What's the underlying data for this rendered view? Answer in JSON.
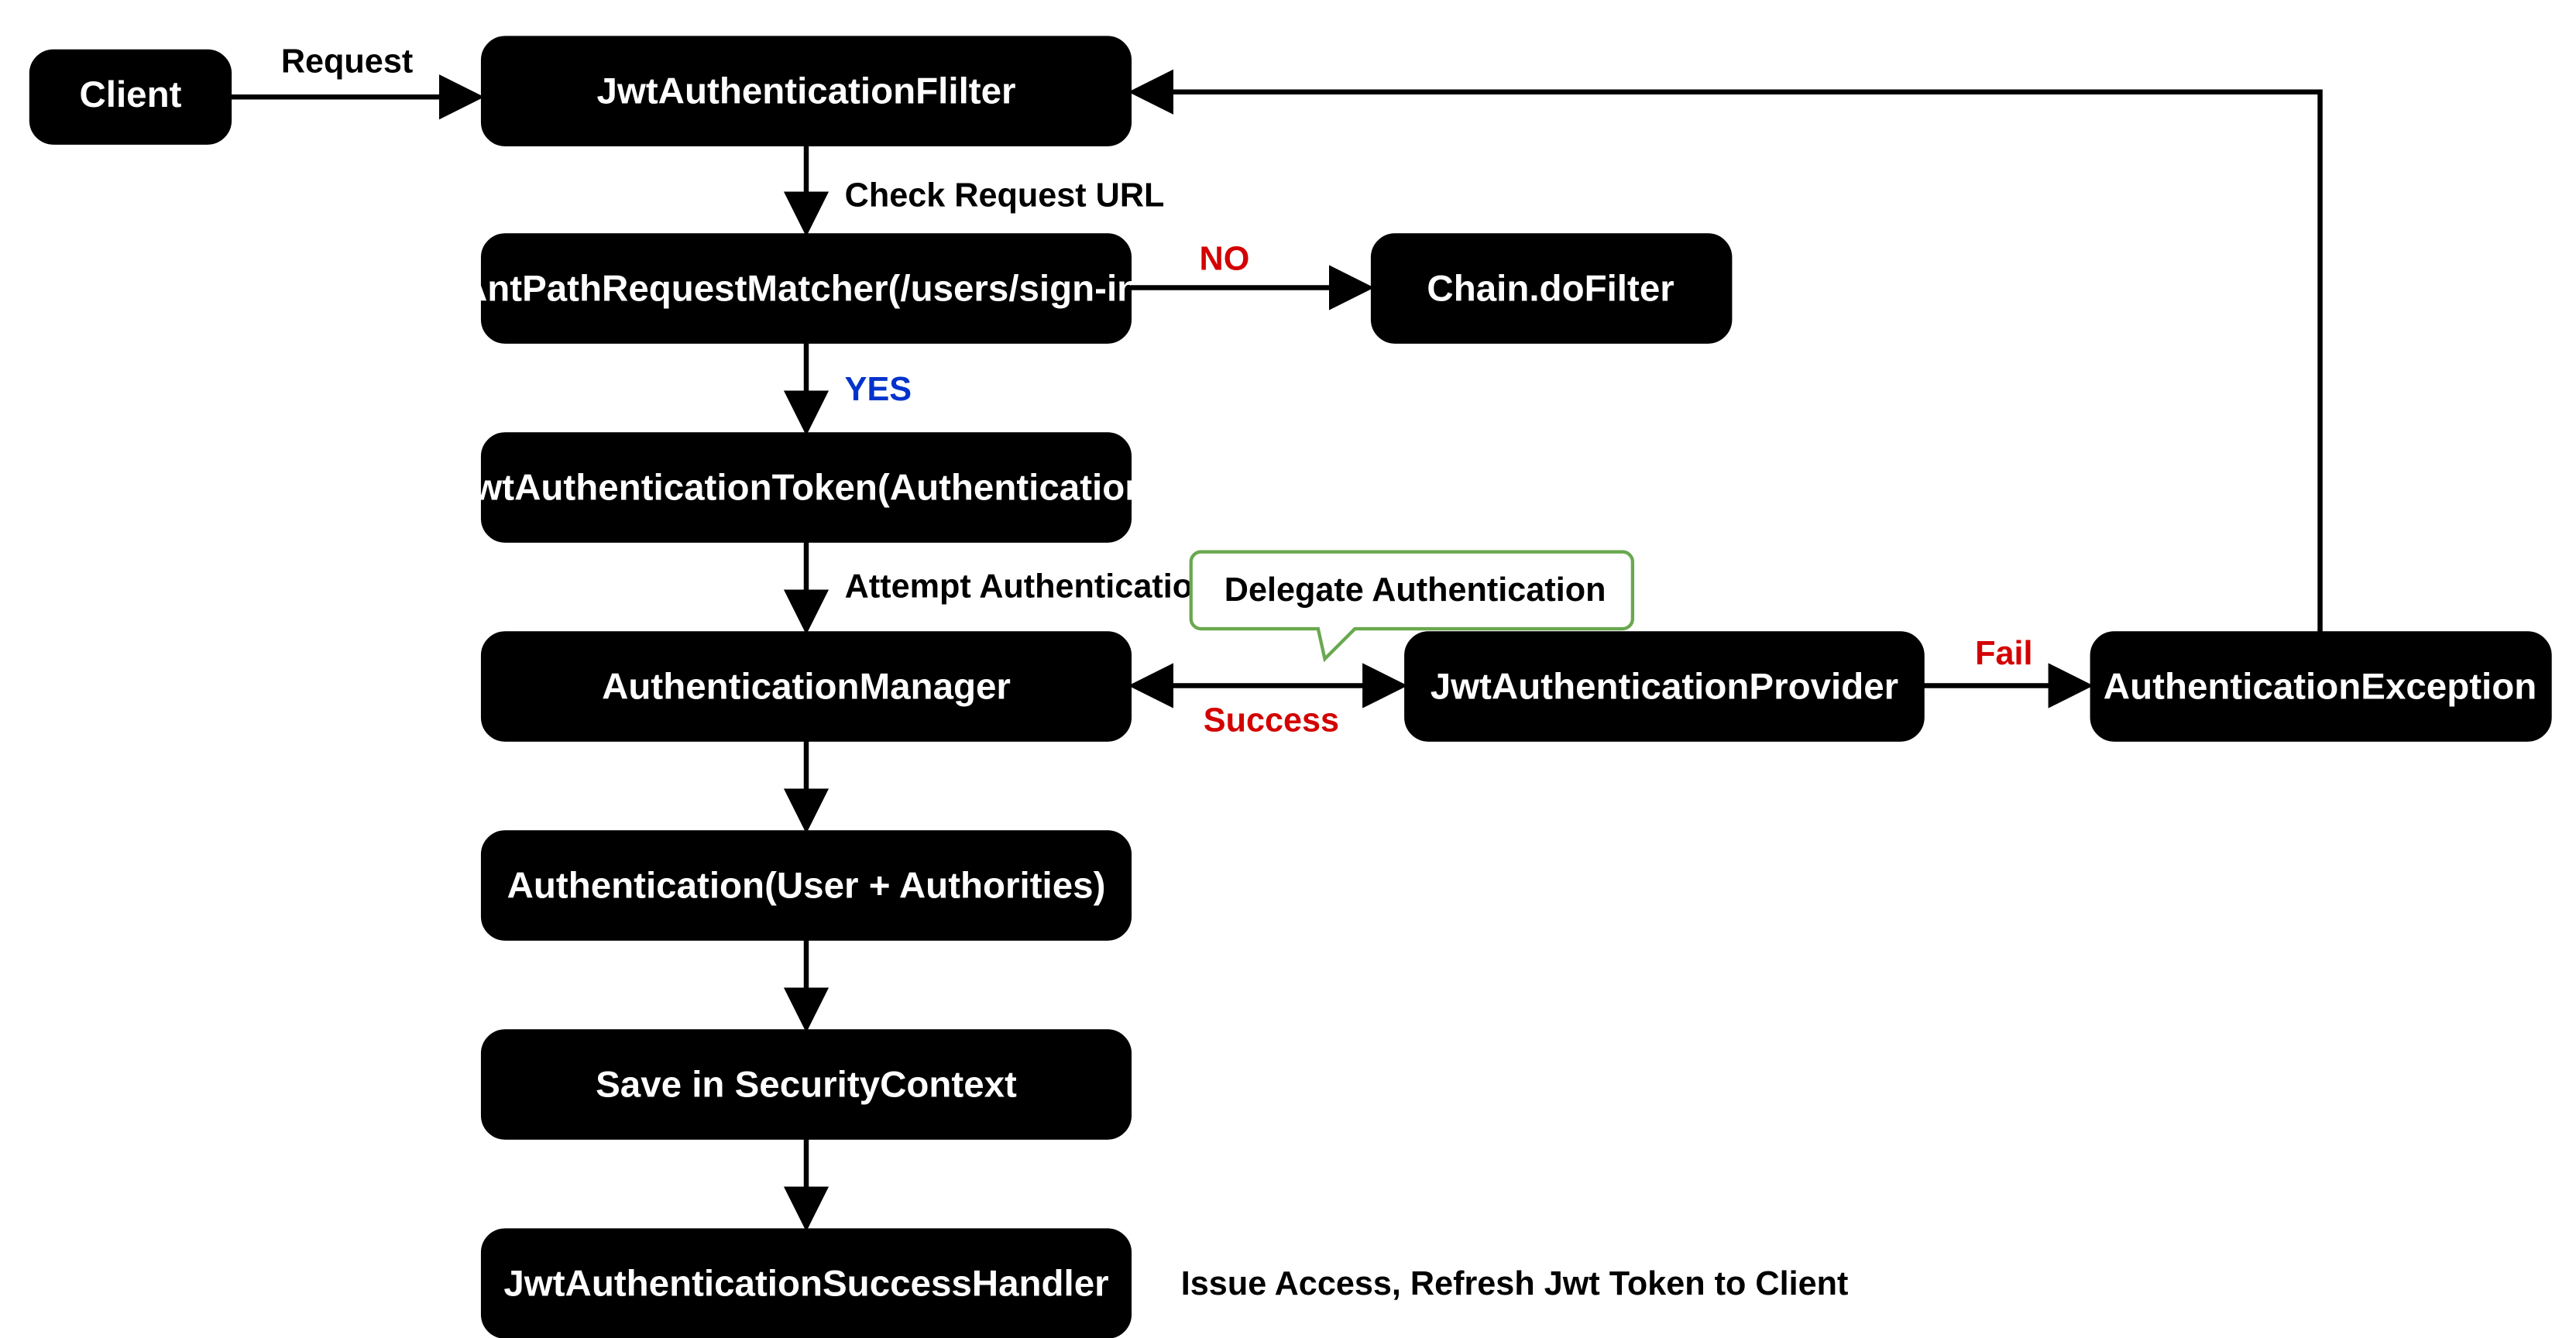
{
  "nodes": {
    "client": "Client",
    "filter": "JwtAuthenticationFlilter",
    "matcher": "AntPathRequestMatcher(/users/sign-in)",
    "token": "JwtAuthenticationToken(Authentication)",
    "manager": "AuthenticationManager",
    "authResult": "Authentication(User + Authorities)",
    "saveCtx": "Save in SecurityContext",
    "successHandler": "JwtAuthenticationSuccessHandler",
    "doFilter": "Chain.doFilter",
    "provider": "JwtAuthenticationProvider",
    "exception": "AuthenticationException"
  },
  "labels": {
    "request": "Request",
    "checkUrl": "Check Request URL",
    "no": "NO",
    "yes": "YES",
    "attempt": "Attempt Authentication",
    "delegate": "Delegate Authentication",
    "success": "Success",
    "fail": "Fail",
    "issue": "Issue Access, Refresh Jwt Token to Client"
  }
}
